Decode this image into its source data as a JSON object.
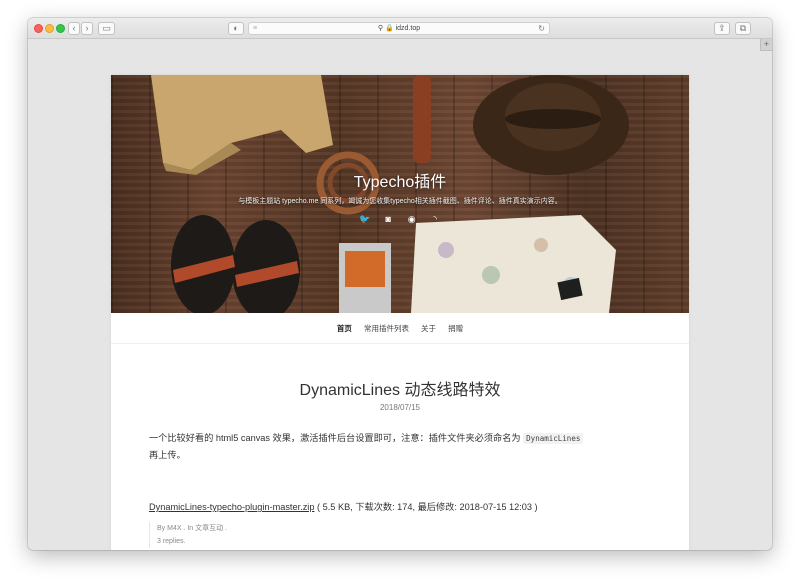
{
  "browser": {
    "url": "idzd.top"
  },
  "site": {
    "title": "Typecho插件",
    "subtitle": "与模板主题站 typecho.me 同系列，竭诚为您收集typecho相关插件截图、插件评论、插件真实演示内容。"
  },
  "nav": {
    "items": [
      "首页",
      "常用插件列表",
      "关于",
      "捐赠"
    ]
  },
  "post": {
    "title": "DynamicLines 动态线路特效",
    "date": "2018/07/15",
    "body_before_code": "一个比较好看的 html5 canvas 效果，激活插件后台设置即可，注意：插件文件夹必须命名为",
    "code": "DynamicLines",
    "body_after_code": "再上传。",
    "download_link": "DynamicLines-typecho-plugin-master.zip",
    "download_info": "( 5.5 KB, 下载次数: 174, 最后修改: 2018-07-15 12:03 )",
    "meta_author": "By M4X . In 文章互动 .",
    "meta_replies": "3 replies."
  },
  "colors": {
    "accent_text": "#333333",
    "hero_wood": "#5a3826"
  }
}
